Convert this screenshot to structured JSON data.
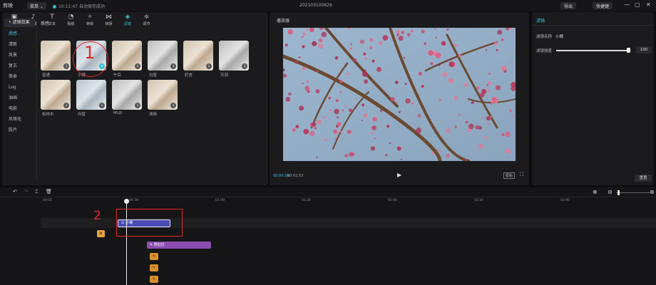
{
  "topbar": {
    "logo": "剪映",
    "menu": "菜单 ⌄",
    "status": "10:11:47 自动保存成功",
    "project_title": "202103100626",
    "export": "导出",
    "shortcut": "快捷键",
    "window_controls": [
      "—",
      "▢",
      "✕"
    ]
  },
  "toolbar": {
    "items": [
      {
        "icon": "▣",
        "label": "视频"
      },
      {
        "icon": "♪",
        "label": "音频"
      },
      {
        "icon": "T",
        "label": "文本"
      },
      {
        "icon": "◔",
        "label": "贴纸"
      },
      {
        "icon": "✧",
        "label": "特效"
      },
      {
        "icon": "⋈",
        "label": "转场"
      },
      {
        "icon": "◈",
        "label": "滤镜"
      },
      {
        "icon": "≑",
        "label": "调节"
      }
    ]
  },
  "categories": {
    "items": [
      "• 滤镜效果",
      "质感",
      "清新",
      "风景",
      "复古",
      "美食",
      "Log",
      "油画",
      "电影",
      "风格化",
      "胶片"
    ]
  },
  "filters": {
    "section_title": "质感",
    "items": [
      {
        "label": "普通",
        "style": "warm"
      },
      {
        "label": "小樽",
        "style": "cold"
      },
      {
        "label": "午后",
        "style": "warm"
      },
      {
        "label": "白皙",
        "style": "gray"
      },
      {
        "label": "奶杏",
        "style": "warm"
      },
      {
        "label": "灰调",
        "style": "gray"
      },
      {
        "label": "柏林木",
        "style": "warm"
      },
      {
        "label": "白皙",
        "style": "cold"
      },
      {
        "label": "MUJI",
        "style": "gray"
      },
      {
        "label": "清晰",
        "style": "warm"
      }
    ]
  },
  "player": {
    "title": "播放器",
    "time_current": "00:00:29",
    "time_total": "00:02:53",
    "play_icon": "▶",
    "ratio_label": "原始",
    "fullscreen_icon": "⛶"
  },
  "inspector": {
    "tab": "滤镜",
    "filter_name_label": "滤镜名称",
    "filter_name_value": "小樽",
    "strength_label": "滤镜强度",
    "strength_value": "100",
    "strength_fraction": 1.0,
    "reset": "重置"
  },
  "timeline": {
    "tools": [
      "↶",
      "↷",
      "⌶",
      "🗑"
    ],
    "ticks": [
      "00:00",
      "00:30",
      "01:00",
      "01:30",
      "02:00",
      "02:30",
      "03:00"
    ],
    "filter_clip": "☷ 小樽",
    "effect_clip": "✎ 霓虹灯",
    "cover_icon": "⚙",
    "small_clips": [
      "✎",
      "✎",
      "✎"
    ]
  },
  "annotations": {
    "one": "1",
    "two": "2"
  },
  "colors": {
    "accent": "#37c3d9",
    "annotation": "#e02828",
    "filter_clip": "#4b4bb3",
    "effect_clip": "#8a4db0"
  }
}
